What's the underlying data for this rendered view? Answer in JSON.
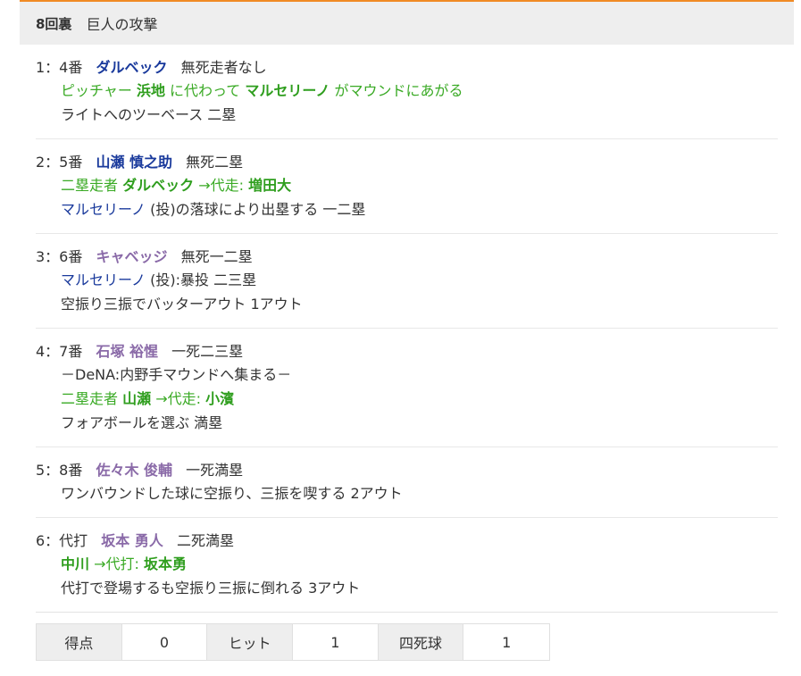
{
  "header": {
    "inning": "8回裏",
    "title": "巨人の攻撃"
  },
  "plays": [
    {
      "num": "1：4番",
      "batter": "ダルベック",
      "situation": "無死走者なし",
      "sub1": {
        "a": "ピッチャー",
        "b": "浜地",
        "c": "に代わって",
        "d": "マルセリーノ",
        "e": "がマウンドにあがる"
      },
      "sub2": "ライトへのツーベース 二塁"
    },
    {
      "num": "2：5番",
      "batter": "山瀬 慎之助",
      "situation": "無死二塁",
      "sub1": {
        "a": "二塁走者",
        "b": "ダルベック",
        "c": "→代走:",
        "d": "増田大"
      },
      "sub2": {
        "a": "マルセリーノ",
        "b": "(投)の落球により出塁する 一二塁"
      }
    },
    {
      "num": "3：6番",
      "batter": "キャベッジ",
      "situation": "無死一二塁",
      "sub1": {
        "a": "マルセリーノ",
        "b": "(投):暴投 二三塁"
      },
      "sub2": "空振り三振でバッターアウト 1アウト"
    },
    {
      "num": "4：7番",
      "batter": "石塚 裕惺",
      "situation": "一死二三塁",
      "sub1": "－DeNA:内野手マウンドへ集まる－",
      "sub2": {
        "a": "二塁走者",
        "b": "山瀬",
        "c": "→代走:",
        "d": "小濱"
      },
      "sub3": "フォアボールを選ぶ 満塁"
    },
    {
      "num": "5：8番",
      "batter": "佐々木 俊輔",
      "situation": "一死満塁",
      "sub1": "ワンバウンドした球に空振り、三振を喫する 2アウト"
    },
    {
      "num": "6：代打",
      "batter": "坂本 勇人",
      "situation": "二死満塁",
      "sub1": {
        "a": "中川",
        "b": "→代打:",
        "c": "坂本勇"
      },
      "sub2": "代打で登場するも空振り三振に倒れる 3アウト"
    }
  ],
  "summary": {
    "runs_label": "得点",
    "runs": "0",
    "hits_label": "ヒット",
    "hits": "1",
    "walks_label": "四死球",
    "walks": "1"
  },
  "colors": {
    "accent": "#f08a24",
    "blue": "#1a3a9c",
    "purple": "#8a6aa8",
    "green": "#3aaa25"
  }
}
